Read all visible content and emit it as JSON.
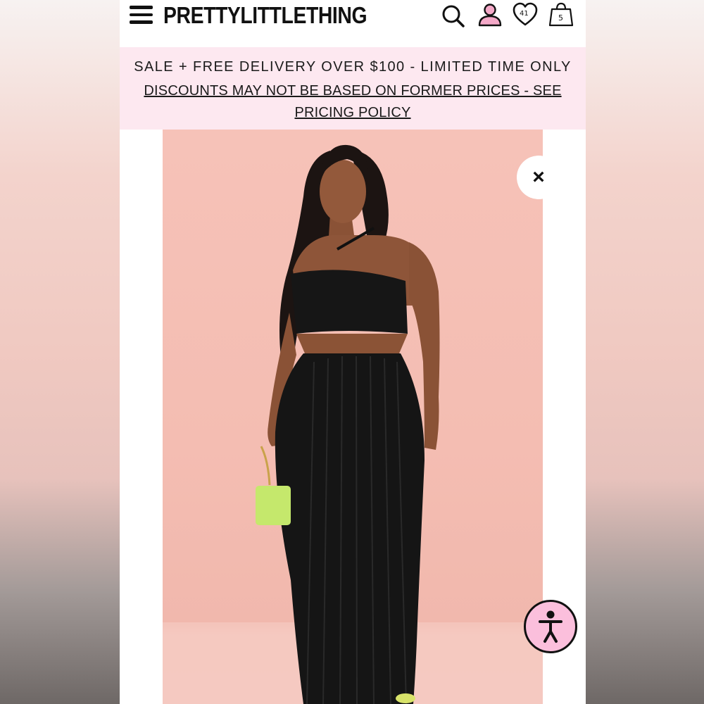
{
  "header": {
    "logo": "PRETTYLITTLETHING",
    "wishlist_count": "41",
    "bag_count": "5"
  },
  "promo": {
    "line1": "SALE + FREE DELIVERY OVER $100 - LIMITED TIME ONLY",
    "link": "DISCOUNTS MAY NOT BE BASED ON FORMER PRICES - SEE PRICING POLICY"
  },
  "buttons": {
    "close_symbol": "×"
  },
  "icons": {
    "menu": "hamburger-menu-icon",
    "search": "search-icon",
    "account": "account-icon",
    "wishlist": "heart-icon",
    "bag": "shopping-bag-icon",
    "close": "close-icon",
    "accessibility": "accessibility-icon"
  },
  "colors": {
    "promo_background": "#fde8f0",
    "account_fill": "#f4a9c8",
    "accessibility_fill": "#fbbfdc",
    "lime_bag": "#c5e86c"
  }
}
